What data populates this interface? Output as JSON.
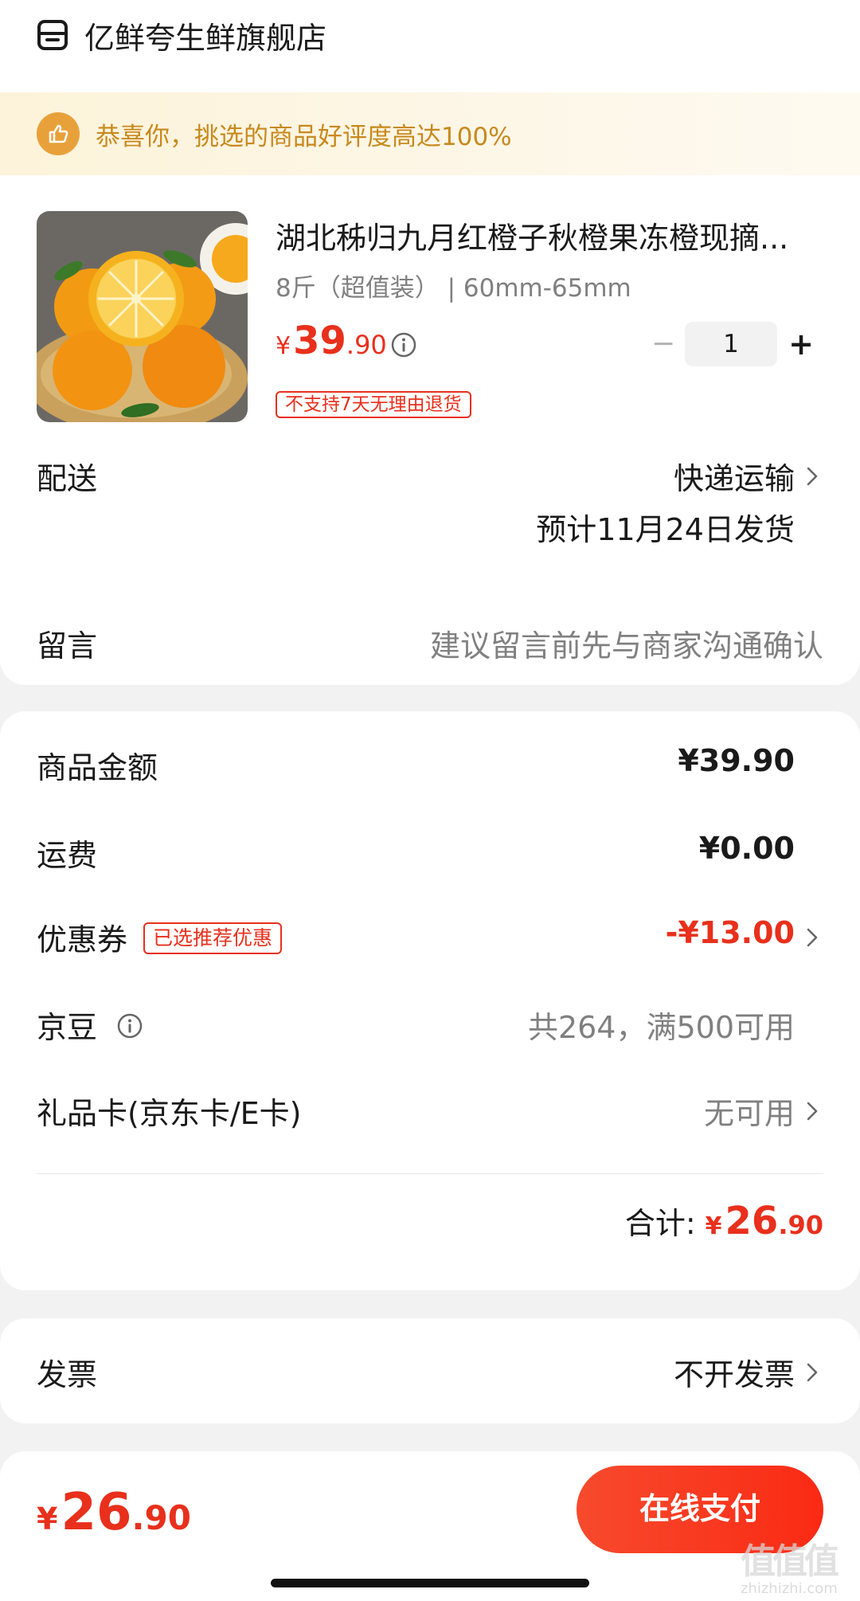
{
  "store": {
    "name": "亿鲜夸生鲜旗舰店",
    "icon": "store-icon"
  },
  "banner": {
    "text": "恭喜你，挑选的商品好评度高达100%",
    "icon": "thumbs-up-icon"
  },
  "product": {
    "title": "湖北秭归九月红橙子秋橙果冻橙现摘...",
    "spec": "8斤（超值装） | 60mm-65mm",
    "price_currency": "¥",
    "price_int": "39",
    "price_dec": ".90",
    "quantity": "1",
    "minus": "−",
    "plus": "+",
    "tag": "不支持7天无理由退货"
  },
  "delivery": {
    "label": "配送",
    "method": "快递运输",
    "ship_date": "预计11月24日发货"
  },
  "message": {
    "label": "留言",
    "placeholder": "建议留言前先与商家沟通确认"
  },
  "amounts": {
    "goods_label": "商品金额",
    "goods_value": "¥39.90",
    "freight_label": "运费",
    "freight_value": "¥0.00",
    "coupon_label": "优惠券",
    "coupon_tag": "已选推荐优惠",
    "coupon_value": "-¥13.00",
    "beans_label": "京豆",
    "beans_value": "共264，满500可用",
    "giftcard_label": "礼品卡(京东卡/E卡)",
    "giftcard_value": "无可用",
    "total_label": "合计:",
    "total_currency": "¥",
    "total_int": "26",
    "total_dec": ".90"
  },
  "invoice": {
    "label": "发票",
    "value": "不开发票"
  },
  "footer": {
    "total_currency": "¥",
    "total_int": "26",
    "total_dec": ".90",
    "pay_label": "在线支付",
    "watermark_logo": "值值值",
    "watermark_url": "zhizhizhi.com"
  },
  "colors": {
    "accent": "#e8301c",
    "banner_text": "#c8891c",
    "banner_icon": "#e8a13a"
  }
}
